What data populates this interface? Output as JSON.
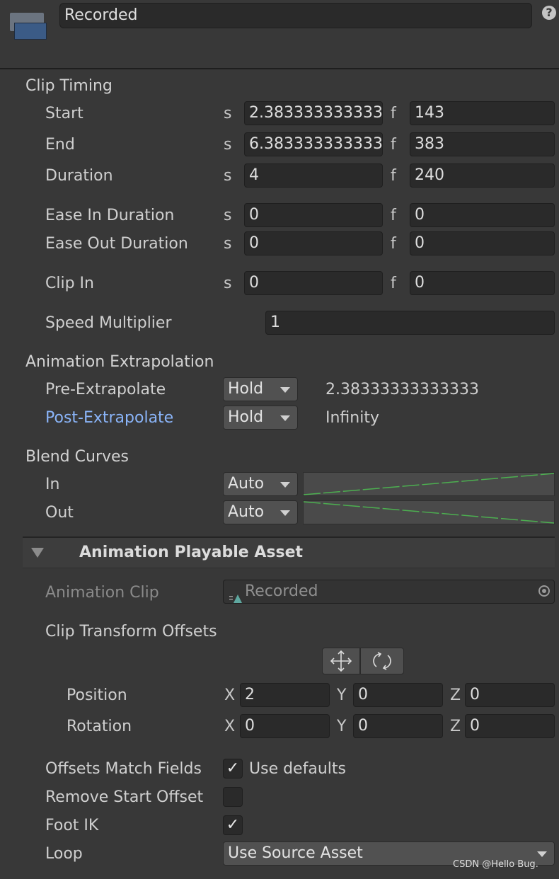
{
  "header": {
    "name_value": "Recorded",
    "help_icon": "?"
  },
  "clip_timing": {
    "title": "Clip Timing",
    "sec_unit": "s",
    "frame_unit": "f",
    "rows": [
      {
        "label": "Start",
        "seconds": "2.38333333333333",
        "frames": "143"
      },
      {
        "label": "End",
        "seconds": "6.38333333333333",
        "frames": "383"
      },
      {
        "label": "Duration",
        "seconds": "4",
        "frames": "240"
      },
      {
        "label": "Ease In Duration",
        "seconds": "0",
        "frames": "0"
      },
      {
        "label": "Ease Out Duration",
        "seconds": "0",
        "frames": "0"
      },
      {
        "label": "Clip In",
        "seconds": "0",
        "frames": "0"
      }
    ],
    "speed_label": "Speed Multiplier",
    "speed_value": "1"
  },
  "extrapolation": {
    "title": "Animation Extrapolation",
    "pre_label": "Pre-Extrapolate",
    "pre_value": "Hold",
    "pre_time": "2.38333333333333",
    "post_label": "Post-Extrapolate",
    "post_value": "Hold",
    "post_time": "Infinity"
  },
  "blend": {
    "title": "Blend Curves",
    "in_label": "In",
    "in_value": "Auto",
    "out_label": "Out",
    "out_value": "Auto"
  },
  "asset": {
    "title": "Animation Playable Asset",
    "clip_label": "Animation Clip",
    "clip_value": "Recorded",
    "offsets_title": "Clip Transform Offsets",
    "position_label": "Position",
    "rotation_label": "Rotation",
    "axis_x": "X",
    "axis_y": "Y",
    "axis_z": "Z",
    "position": {
      "x": "2",
      "y": "0",
      "z": "0"
    },
    "rotation": {
      "x": "0",
      "y": "0",
      "z": "0"
    },
    "match_label": "Offsets Match Fields",
    "match_checked": true,
    "match_text": "Use defaults",
    "remove_label": "Remove Start Offset",
    "remove_checked": false,
    "footik_label": "Foot IK",
    "footik_checked": true,
    "loop_label": "Loop",
    "loop_value": "Use Source Asset"
  },
  "watermark": "CSDN @Hello Bug.",
  "colors": {
    "background": "#383838",
    "field": "#2a2a2a",
    "link": "#8ab4f8",
    "curve": "#4caf50"
  }
}
